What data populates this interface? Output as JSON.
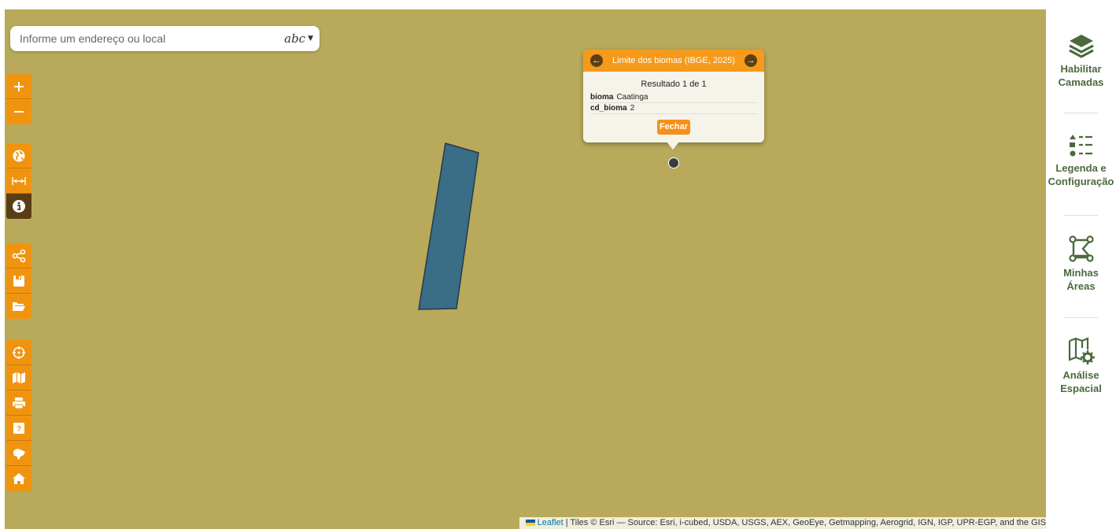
{
  "search": {
    "placeholder": "Informe um endereço ou local",
    "mode_label": "abc"
  },
  "popup": {
    "title": "Limite dos biomas (IBGE, 2025)",
    "result": "Resultado 1 de 1",
    "attributes": [
      {
        "key": "bioma",
        "value": "Caatinga"
      },
      {
        "key": "cd_bioma",
        "value": "2"
      }
    ],
    "close_label": "Fechar"
  },
  "attribution": {
    "leaflet": "Leaflet",
    "text": "| Tiles © Esri — Source: Esri, i-cubed, USDA, USGS, AEX, GeoEye, Getmapping, Aerogrid, IGN, IGP, UPR-EGP, and the GIS User Community"
  },
  "sidebar": {
    "layers": {
      "line1": "Habilitar",
      "line2": "Camadas"
    },
    "legend": {
      "line1": "Legenda e",
      "line2": "Configuração"
    },
    "areas": {
      "line1": "Minhas",
      "line2": "Áreas"
    },
    "analysis": {
      "line1": "Análise",
      "line2": "Espacial"
    }
  },
  "colors": {
    "map_background": "#b8aa5a",
    "polygon_fill": "#3a6d86",
    "tool_orange": "#f0940f",
    "tool_active": "#5a3d14",
    "sidebar_text": "#4a6a3c"
  },
  "tools": {
    "zoom": [
      "plus-icon",
      "minus-icon"
    ],
    "group2": [
      "globe-icon",
      "ruler-icon",
      "info-icon"
    ],
    "group3": [
      "share-icon",
      "save-icon",
      "folder-open-icon"
    ],
    "group4": [
      "crosshair-icon",
      "map-icon",
      "print-icon",
      "help-icon",
      "brazil-map-icon",
      "home-icon"
    ],
    "active": "info-icon"
  }
}
